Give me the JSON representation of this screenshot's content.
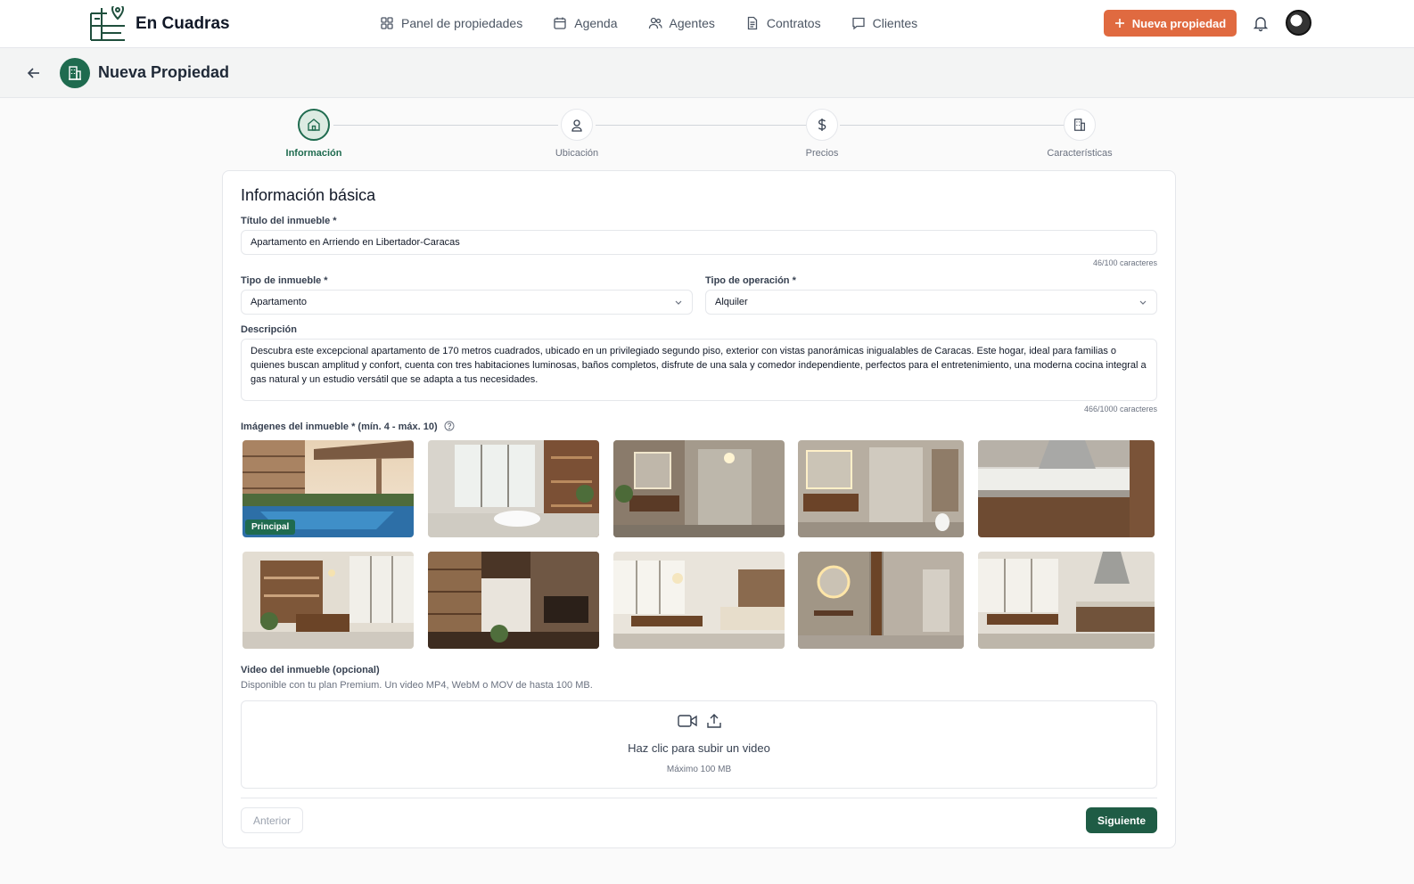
{
  "app": {
    "brand": "En Cuadras"
  },
  "nav": {
    "items": [
      {
        "label": "Panel de propiedades",
        "icon": "grid-icon"
      },
      {
        "label": "Agenda",
        "icon": "calendar-icon"
      },
      {
        "label": "Agentes",
        "icon": "users-icon"
      },
      {
        "label": "Contratos",
        "icon": "document-icon"
      },
      {
        "label": "Clientes",
        "icon": "chat-icon"
      }
    ],
    "new_button": "Nueva propiedad"
  },
  "page": {
    "title": "Nueva Propiedad"
  },
  "stepper": {
    "steps": [
      {
        "label": "Información",
        "icon": "home-icon",
        "active": true
      },
      {
        "label": "Ubicación",
        "icon": "location-pin-icon",
        "active": false
      },
      {
        "label": "Precios",
        "icon": "dollar-icon",
        "active": false
      },
      {
        "label": "Características",
        "icon": "building-icon",
        "active": false
      }
    ]
  },
  "form": {
    "section_title": "Información básica",
    "title_label": "Título del inmueble *",
    "title_value": "Apartamento en Arriendo en Libertador-Caracas",
    "title_counter": "46/100 caracteres",
    "type_label": "Tipo de inmueble *",
    "type_value": "Apartamento",
    "operation_label": "Tipo de operación *",
    "operation_value": "Alquiler",
    "description_label": "Descripción",
    "description_value": "Descubra este excepcional apartamento de 170 metros cuadrados, ubicado en un privilegiado segundo piso, exterior con vistas panorámicas inigualables de Caracas. Este hogar, ideal para familias o quienes buscan amplitud y confort, cuenta con tres habitaciones luminosas, baños completos, disfrute de una sala y comedor independiente, perfectos para el entretenimiento, una moderna cocina integral a gas natural y un estudio versátil que se adapta a tus necesidades.",
    "description_counter": "466/1000 caracteres",
    "images_label": "Imágenes del inmueble * (mín. 4 - máx. 10)",
    "principal_badge": "Principal",
    "video_label": "Video del inmueble (opcional)",
    "video_description": "Disponible con tu plan Premium. Un video MP4, WebM o MOV de hasta 100 MB.",
    "dropzone_title": "Haz clic para subir un video",
    "dropzone_sub": "Máximo 100 MB",
    "prev_button": "Anterior",
    "next_button": "Siguiente"
  },
  "colors": {
    "brand_green": "#1f6b4f",
    "accent_orange": "#e06a40"
  }
}
